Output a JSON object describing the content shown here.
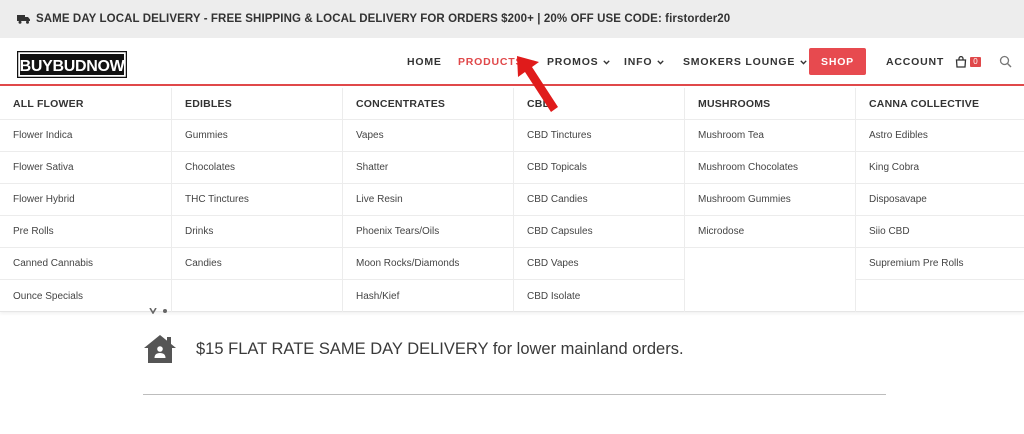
{
  "announcement": "SAME DAY LOCAL DELIVERY - FREE SHIPPING & LOCAL DELIVERY FOR ORDERS $200+ | 20% OFF USE CODE: firstorder20",
  "logo_text": "BUYBUDNOW",
  "nav": {
    "home": "HOME",
    "products": "PRODUCTS",
    "promos": "PROMOS",
    "info": "INFO",
    "smokers_lounge": "SMOKERS LOUNGE",
    "shop": "SHOP",
    "account": "ACCOUNT",
    "cart_count": "0"
  },
  "menu": {
    "all_flower": {
      "title": "ALL FLOWER",
      "items": [
        "Flower Indica",
        "Flower Sativa",
        "Flower Hybrid",
        "Pre Rolls",
        "Canned Cannabis",
        "Ounce Specials"
      ]
    },
    "edibles": {
      "title": "EDIBLES",
      "items": [
        "Gummies",
        "Chocolates",
        "THC Tinctures",
        "Drinks",
        "Candies"
      ]
    },
    "concentrates": {
      "title": "CONCENTRATES",
      "items": [
        "Vapes",
        "Shatter",
        "Live Resin",
        "Phoenix Tears/Oils",
        "Moon Rocks/Diamonds",
        "Hash/Kief"
      ]
    },
    "cbd": {
      "title": "CBD",
      "items": [
        "CBD Tinctures",
        "CBD Topicals",
        "CBD Candies",
        "CBD Capsules",
        "CBD Vapes",
        "CBD Isolate"
      ]
    },
    "mushrooms": {
      "title": "MUSHROOMS",
      "items": [
        "Mushroom Tea",
        "Mushroom Chocolates",
        "Mushroom Gummies",
        "Microdose"
      ]
    },
    "canna_collective": {
      "title": "CANNA COLLECTIVE",
      "items": [
        "Astro Edibles",
        "King Cobra",
        "Disposavape",
        "Siio CBD",
        "Supremium Pre Rolls"
      ]
    }
  },
  "delivery_text": "$15 FLAT RATE SAME DAY DELIVERY for lower mainland orders.",
  "colors": {
    "accent": "#e0484a",
    "topbar_bg": "#ededed",
    "text": "#333333"
  }
}
